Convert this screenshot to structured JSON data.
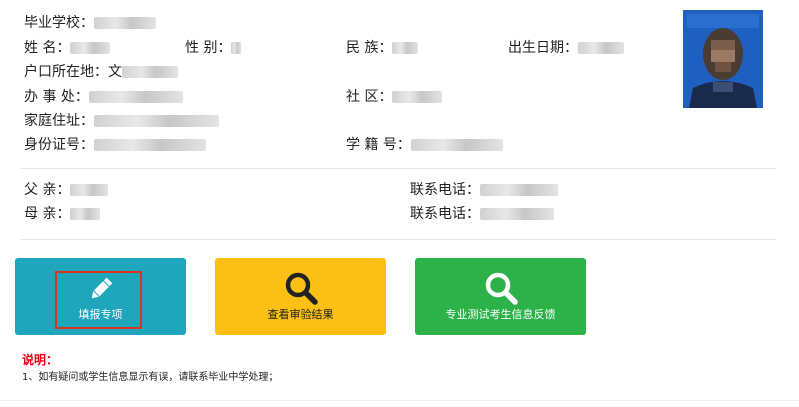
{
  "student": {
    "school_label": "毕业学校：",
    "name_label": "姓 名：",
    "gender_label": "性 别：",
    "ethnicity_label": "民 族：",
    "birthdate_label": "出生日期：",
    "hukou_label": "户口所在地：",
    "hukou_prefix": "文",
    "office_label": "办 事 处：",
    "community_label": "社 区：",
    "address_label": "家庭住址：",
    "id_label": "身份证号：",
    "student_no_label": "学 籍 号："
  },
  "parents": {
    "father_label": "父 亲：",
    "father_phone_label": "联系电话：",
    "mother_label": "母 亲：",
    "mother_phone_label": "联系电话："
  },
  "buttons": {
    "fill": {
      "label": "填报专项",
      "color": "#1fa5bc",
      "icon": "pencil-icon"
    },
    "review": {
      "label": "查看审验结果",
      "color": "#fcc015",
      "icon": "search-icon"
    },
    "feedback": {
      "label": "专业测试考生信息反馈",
      "color": "#2db249",
      "icon": "search-icon"
    }
  },
  "highlight_color": "#e0301e",
  "notes": {
    "title": "说明：",
    "items": [
      "1、如有疑问或学生信息显示有误，请联系毕业中学处理；"
    ]
  }
}
